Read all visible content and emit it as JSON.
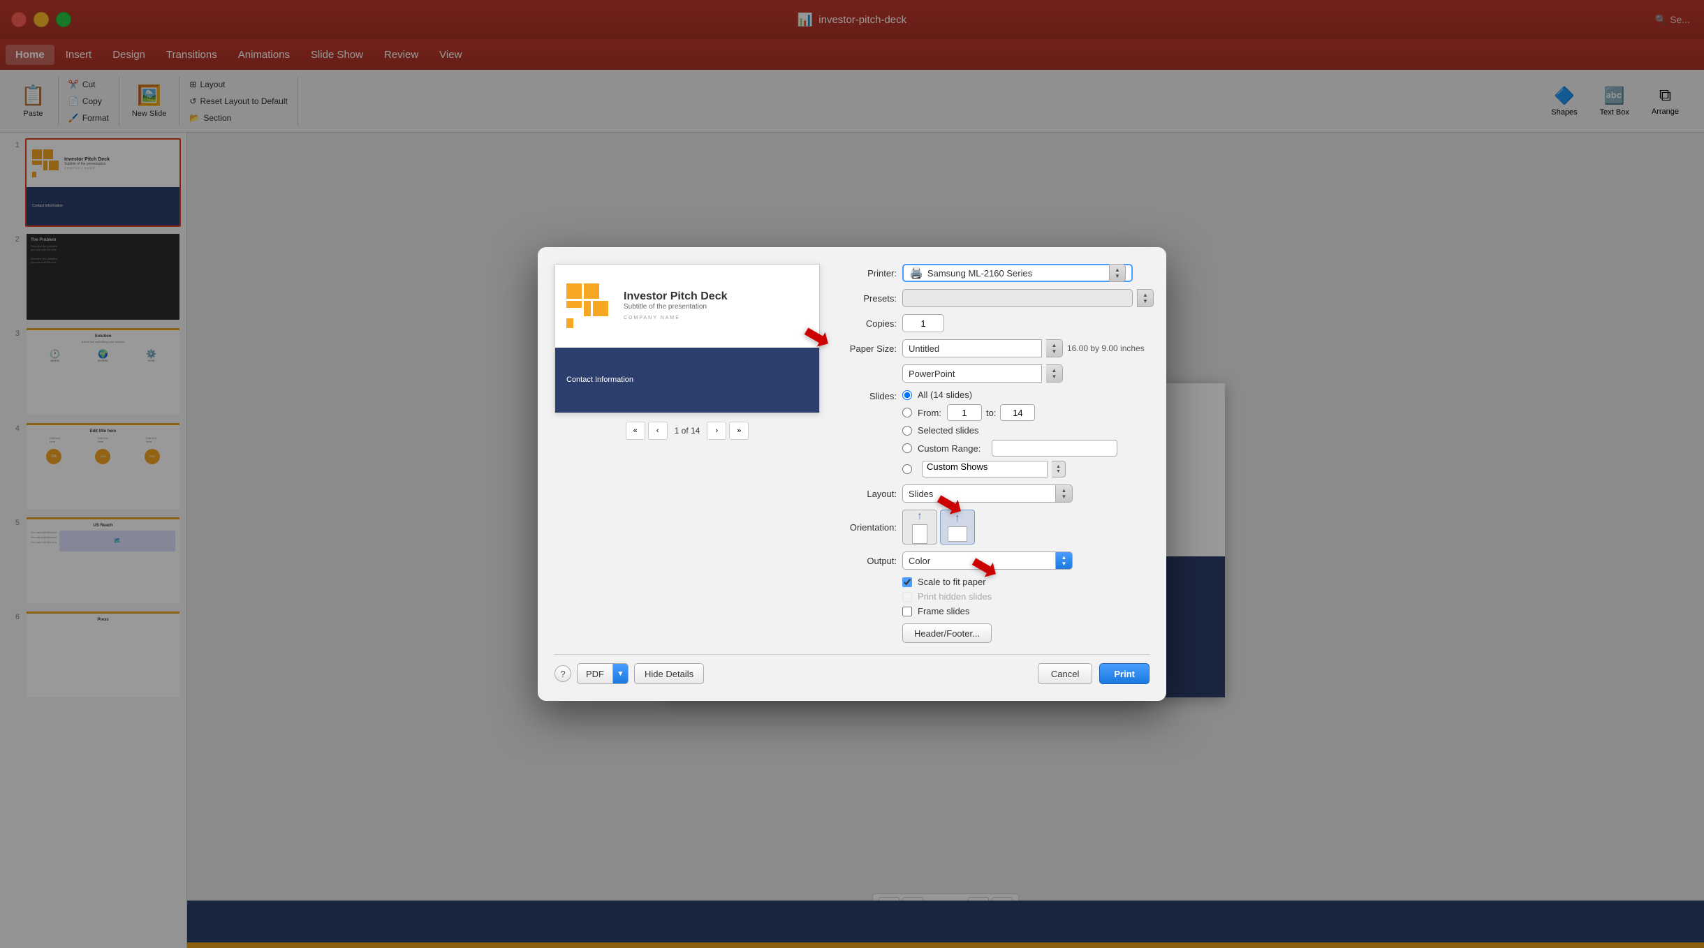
{
  "app": {
    "title": "investor-pitch-deck",
    "icon": "📊"
  },
  "search": {
    "placeholder": "Se..."
  },
  "menubar": {
    "items": [
      "Home",
      "Insert",
      "Design",
      "Transitions",
      "Animations",
      "Slide Show",
      "Review",
      "View"
    ]
  },
  "toolbar": {
    "paste_label": "Paste",
    "cut_label": "Cut",
    "copy_label": "Copy",
    "format_label": "Format",
    "new_slide_label": "New Slide",
    "layout_label": "Layout",
    "reset_layout_label": "Reset Layout to Default",
    "section_label": "Section",
    "shapes_label": "Shapes",
    "text_box_label": "Text Box",
    "arrange_label": "Arrange"
  },
  "slides": {
    "list": [
      {
        "num": "1",
        "title": "Investor Pitch Deck"
      },
      {
        "num": "2",
        "title": "The Problem"
      },
      {
        "num": "3",
        "title": "Solution"
      },
      {
        "num": "4",
        "title": "Edit title here"
      },
      {
        "num": "5",
        "title": "US Reach"
      },
      {
        "num": "6",
        "title": "Press"
      }
    ]
  },
  "nav": {
    "page": "1 of 14",
    "first_label": "«",
    "prev_label": "‹",
    "next_label": "›",
    "last_label": "»"
  },
  "slide_content": {
    "title": "Investor Pitch Deck",
    "subtitle": "Subtitle of the presentation",
    "company": "COMPANY NAME",
    "contact": "Contact Information"
  },
  "print_dialog": {
    "printer_label": "Printer:",
    "printer_value": "Samsung ML-2160 Series",
    "presets_label": "Presets:",
    "copies_label": "Copies:",
    "copies_value": "1",
    "paper_size_label": "Paper Size:",
    "paper_size_value": "Untitled",
    "paper_size_dim": "16.00 by 9.00 inches",
    "format_value": "PowerPoint",
    "slides_label": "Slides:",
    "slides_all_label": "All  (14 slides)",
    "slides_from_label": "From:",
    "slides_from_value": "1",
    "slides_to_label": "to:",
    "slides_to_value": "14",
    "slides_selected_label": "Selected slides",
    "slides_custom_range_label": "Custom Range:",
    "slides_custom_shows_label": "Custom Shows",
    "layout_label": "Layout:",
    "layout_value": "Slides",
    "orientation_label": "Orientation:",
    "output_label": "Output:",
    "output_value": "Color",
    "scale_to_fit_label": "Scale to fit paper",
    "print_hidden_label": "Print hidden slides",
    "frame_slides_label": "Frame slides",
    "header_footer_label": "Header/Footer...",
    "pdf_label": "PDF",
    "hide_details_label": "Hide Details",
    "cancel_label": "Cancel",
    "print_label": "Print",
    "nav_page": "1 of 14",
    "nav_first": "«",
    "nav_prev": "‹",
    "nav_next": "›",
    "nav_last": "»"
  }
}
